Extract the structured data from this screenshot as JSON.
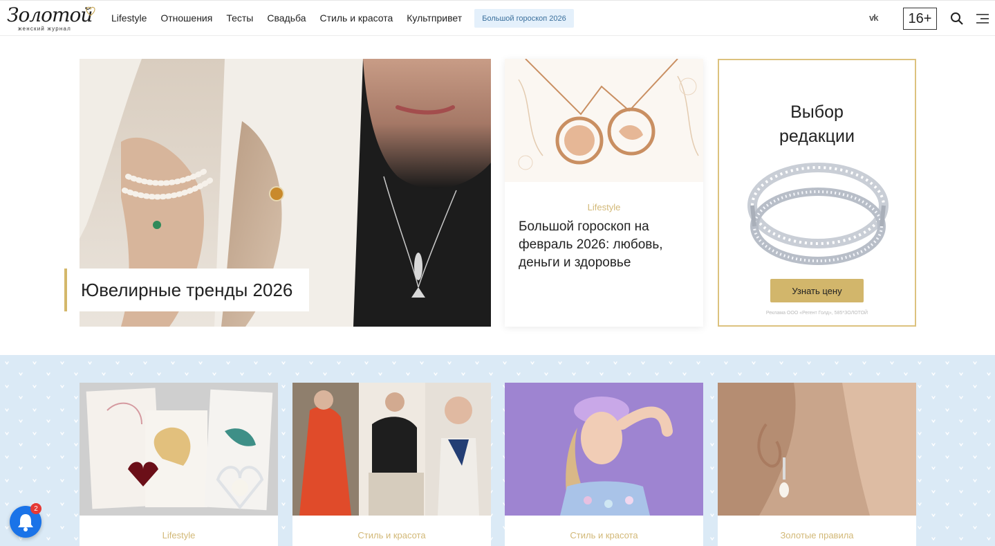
{
  "header": {
    "logo_script": "Золотой",
    "logo_subtitle": "женский журнал",
    "nav": [
      {
        "label": "Lifestyle"
      },
      {
        "label": "Отношения"
      },
      {
        "label": "Тесты"
      },
      {
        "label": "Свадьба"
      },
      {
        "label": "Стиль и красота"
      },
      {
        "label": "Культпривет"
      }
    ],
    "promo_label": "Большой гороскоп 2026",
    "social": "vk",
    "age_rating": "16+"
  },
  "featured": {
    "hero_title": "Ювелирные тренды 2026",
    "card": {
      "category": "Lifestyle",
      "title": "Большой гороскоп на февраль 2026: любовь, деньги и здоровье"
    },
    "ad": {
      "title_line1": "Выбор",
      "title_line2": "редакции",
      "button": "Узнать цену",
      "legal": "Реклама ООО «Регент Голд», 585*ЗОЛОТОЙ"
    }
  },
  "grid": [
    {
      "category": "Lifestyle"
    },
    {
      "category": "Стиль и красота"
    },
    {
      "category": "Стиль и красота"
    },
    {
      "category": "Золотые правила"
    }
  ],
  "notifications": {
    "count": "2"
  },
  "colors": {
    "accent_gold": "#d2b66b",
    "band_blue": "#dbeaf6",
    "notif_blue": "#1a73e8"
  }
}
